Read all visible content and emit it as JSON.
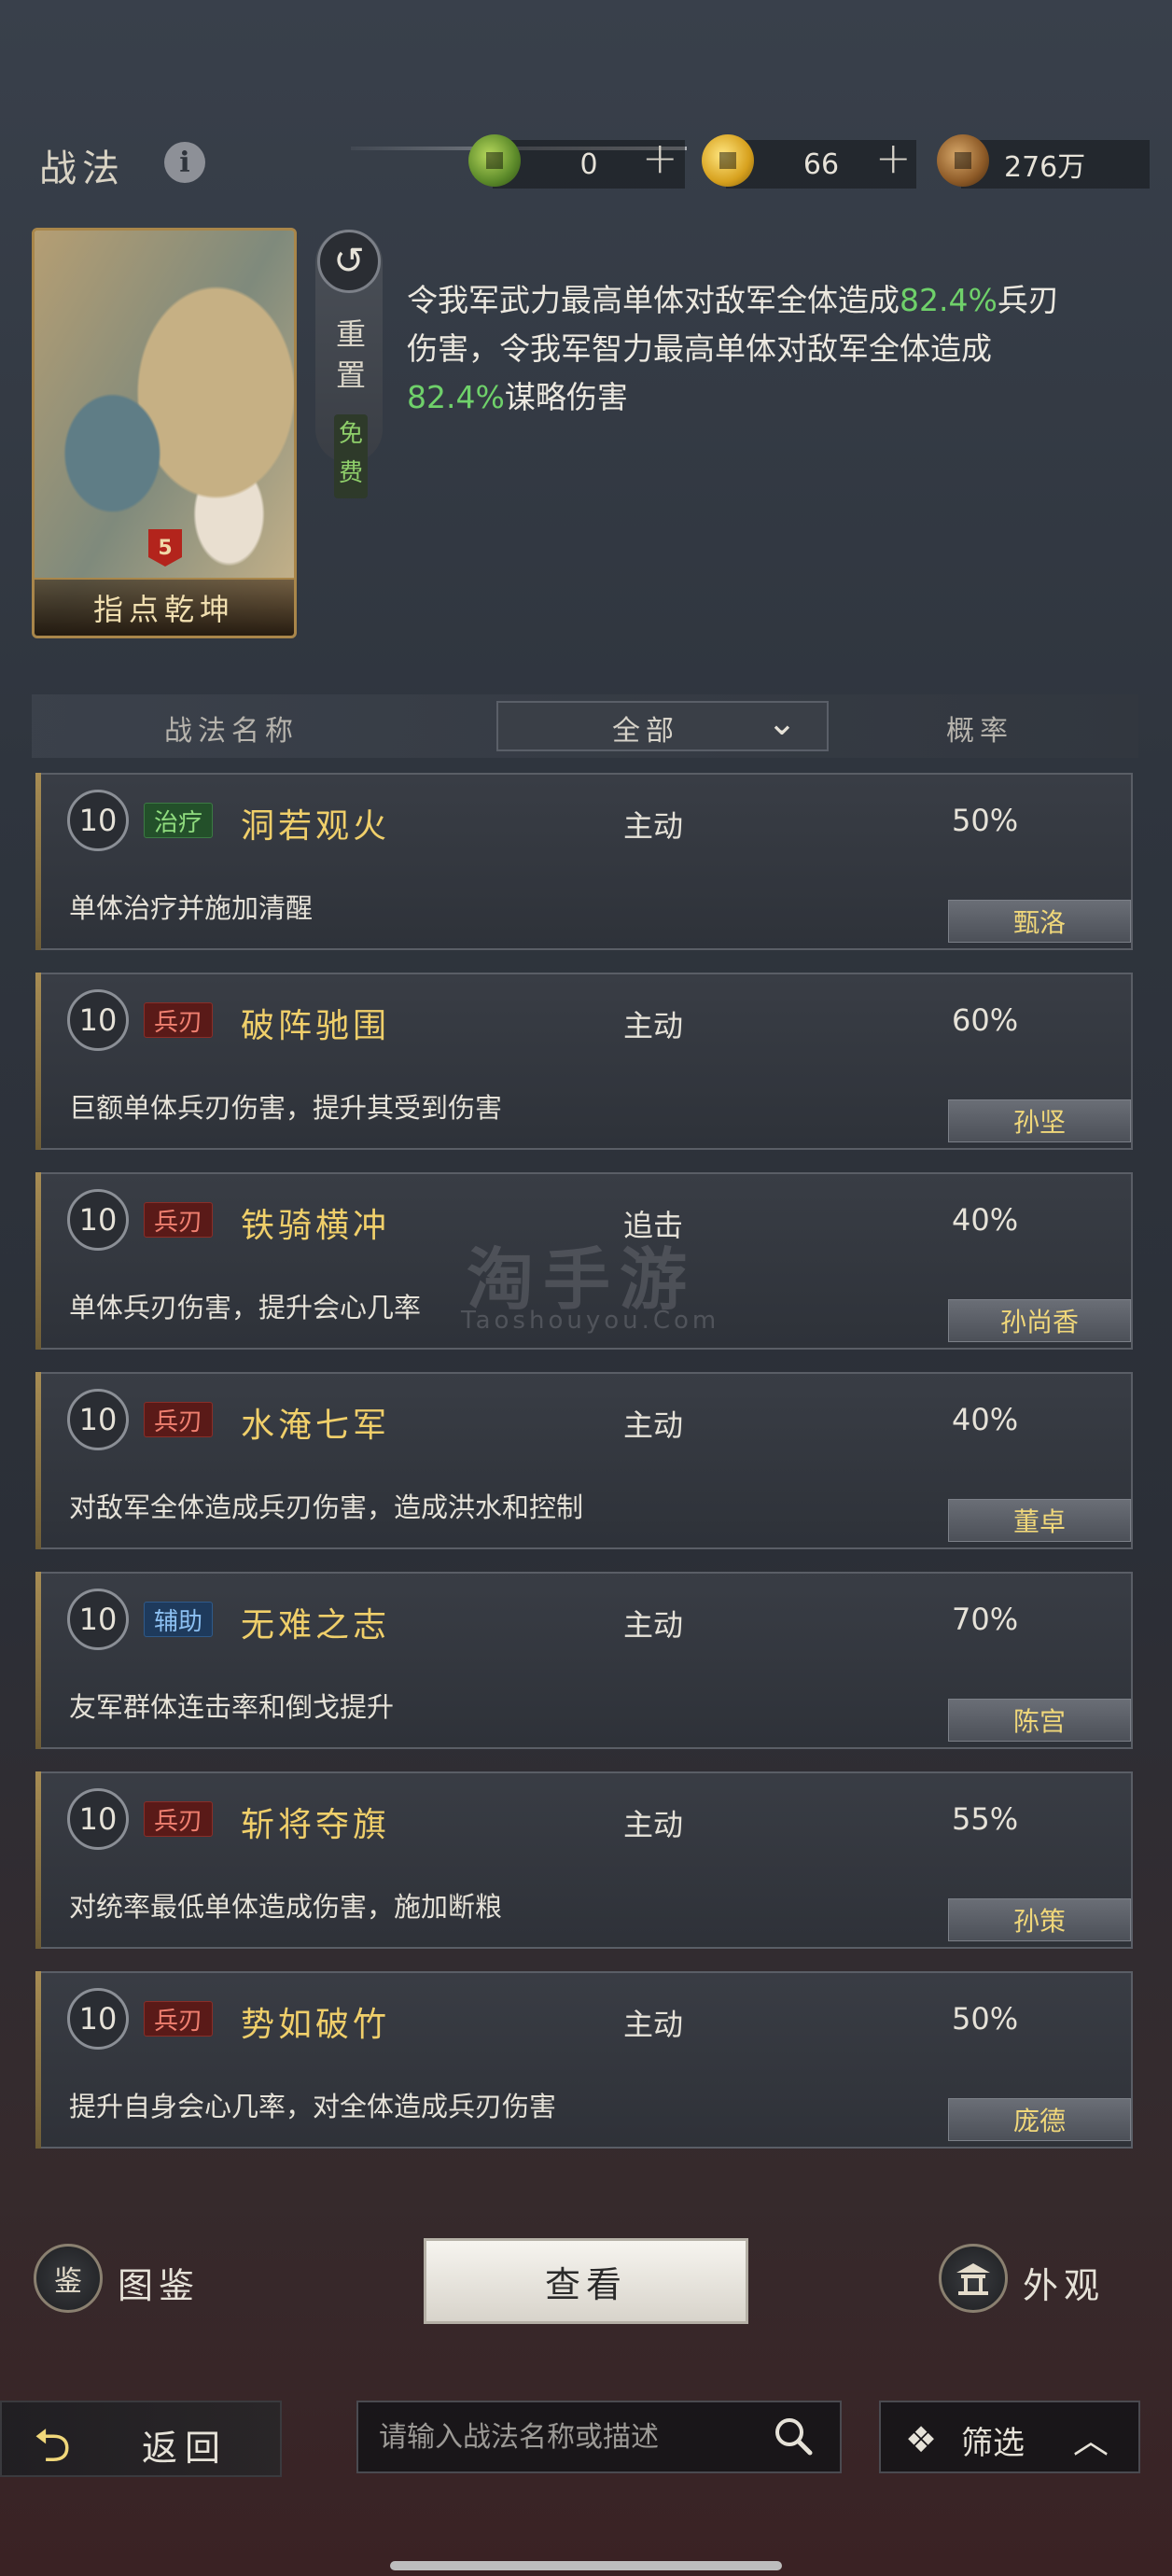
{
  "header": {
    "title": "战法",
    "currencies": [
      {
        "icon": "jade-coin-icon",
        "value": "0"
      },
      {
        "icon": "gold-coin-icon",
        "value": "66"
      },
      {
        "icon": "copper-coin-icon",
        "value": "276万"
      }
    ],
    "plus_symbol": "+"
  },
  "selected_skill": {
    "card_name": "指点乾坤",
    "card_badge": "5",
    "reset_label": "重置",
    "free_label": "免费",
    "description_parts": [
      {
        "text": "令我军武力最高单体对敌军全体造成",
        "highlight": false
      },
      {
        "text": "82.4%",
        "highlight": true
      },
      {
        "text": "兵刃伤害，令我军智力最高单体对敌军全体造成",
        "highlight": false
      },
      {
        "text": "82.4%",
        "highlight": true
      },
      {
        "text": "谋略伤害",
        "highlight": false
      }
    ]
  },
  "table": {
    "col_name": "战法名称",
    "filter_value": "全部",
    "col_rate": "概率"
  },
  "skills": [
    {
      "level": "10",
      "tag": "治疗",
      "tag_type": "heal",
      "name": "洞若观火",
      "type": "主动",
      "rate": "50%",
      "desc": "单体治疗并施加清醒",
      "owner": "甄洛"
    },
    {
      "level": "10",
      "tag": "兵刃",
      "tag_type": "blade",
      "name": "破阵驰围",
      "type": "主动",
      "rate": "60%",
      "desc": "巨额单体兵刃伤害，提升其受到伤害",
      "owner": "孙坚"
    },
    {
      "level": "10",
      "tag": "兵刃",
      "tag_type": "blade",
      "name": "铁骑横冲",
      "type": "追击",
      "rate": "40%",
      "desc": "单体兵刃伤害，提升会心几率",
      "owner": "孙尚香"
    },
    {
      "level": "10",
      "tag": "兵刃",
      "tag_type": "blade",
      "name": "水淹七军",
      "type": "主动",
      "rate": "40%",
      "desc": "对敌军全体造成兵刃伤害，造成洪水和控制",
      "owner": "董卓"
    },
    {
      "level": "10",
      "tag": "辅助",
      "tag_type": "aux",
      "name": "无难之志",
      "type": "主动",
      "rate": "70%",
      "desc": "友军群体连击率和倒戈提升",
      "owner": "陈宫"
    },
    {
      "level": "10",
      "tag": "兵刃",
      "tag_type": "blade",
      "name": "斩将夺旗",
      "type": "主动",
      "rate": "55%",
      "desc": "对统率最低单体造成伤害，施加断粮",
      "owner": "孙策"
    },
    {
      "level": "10",
      "tag": "兵刃",
      "tag_type": "blade",
      "name": "势如破竹",
      "type": "主动",
      "rate": "50%",
      "desc": "提升自身会心几率，对全体造成兵刃伤害",
      "owner": "庞德"
    }
  ],
  "watermark": {
    "main": "淘手游",
    "sub": "Taoshouyou.Com"
  },
  "bottom": {
    "codex_icon_text": "鉴",
    "codex_label": "图鉴",
    "view_label": "查看",
    "appearance_label": "外观",
    "back_label": "返回",
    "search_placeholder": "请输入战法名称或描述",
    "filter_label": "筛选"
  },
  "colors": {
    "highlight": "#6fd16a",
    "skill_name": "#f0cf6a",
    "owner": "#f0d77a"
  }
}
